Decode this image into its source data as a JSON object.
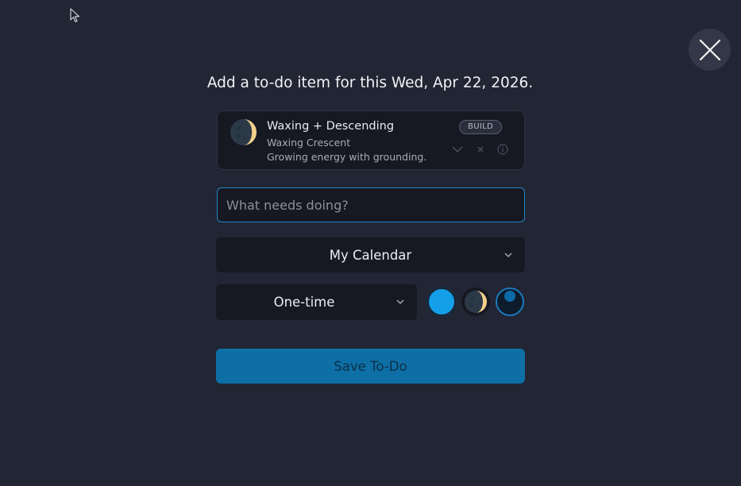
{
  "heading": "Add a to-do item for this Wed, Apr 22, 2026.",
  "phase_card": {
    "title": "Waxing + Descending",
    "phase_name": "Waxing Crescent",
    "description": "Growing energy with grounding.",
    "badge": "BUILD",
    "moon_icon": "waxing-crescent-moon-icon",
    "actions": [
      "chevron-down-icon",
      "close-icon",
      "info-icon"
    ]
  },
  "todo_input": {
    "placeholder": "What needs doing?",
    "value": ""
  },
  "calendar_select": {
    "selected": "My Calendar"
  },
  "repeat_select": {
    "selected": "One-time"
  },
  "color_swatches": [
    {
      "name": "blue-swatch",
      "color": "#13a0e8"
    },
    {
      "name": "moon-swatch",
      "icon": "waxing-crescent-moon-icon"
    },
    {
      "name": "dark-swatch",
      "color": "#0d1b2b",
      "selected": true
    }
  ],
  "save_button": "Save To-Do",
  "colors": {
    "background": "#222534",
    "card": "#161822",
    "accent": "#0e6fa6",
    "focus_border": "#1e88c9"
  }
}
